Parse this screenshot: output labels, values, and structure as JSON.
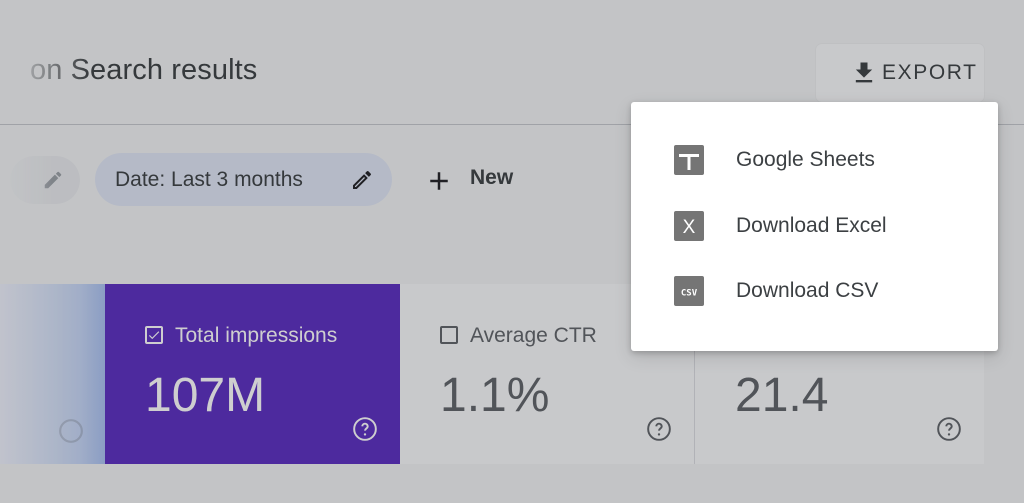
{
  "header": {
    "title": "on Search results",
    "export_label": "EXPORT",
    "export_icon": "download-icon"
  },
  "filters": {
    "date_chip_label": "Date: Last 3 months",
    "new_label": "New"
  },
  "metrics": [
    {
      "label": "Total impressions",
      "value": "107M",
      "checked": true
    },
    {
      "label": "Average CTR",
      "value": "1.1%",
      "checked": false
    },
    {
      "label": "",
      "value": "21.4",
      "checked": false
    }
  ],
  "export_menu": {
    "items": [
      {
        "label": "Google Sheets",
        "icon": "google-sheets-icon"
      },
      {
        "label": "Download Excel",
        "icon": "excel-icon",
        "glyph": "X"
      },
      {
        "label": "Download CSV",
        "icon": "csv-icon",
        "glyph": "CSV"
      }
    ]
  },
  "colors": {
    "active_card": "#5a2ec0",
    "date_chip": "#dfe6f5",
    "menu_icon": "#757575"
  }
}
